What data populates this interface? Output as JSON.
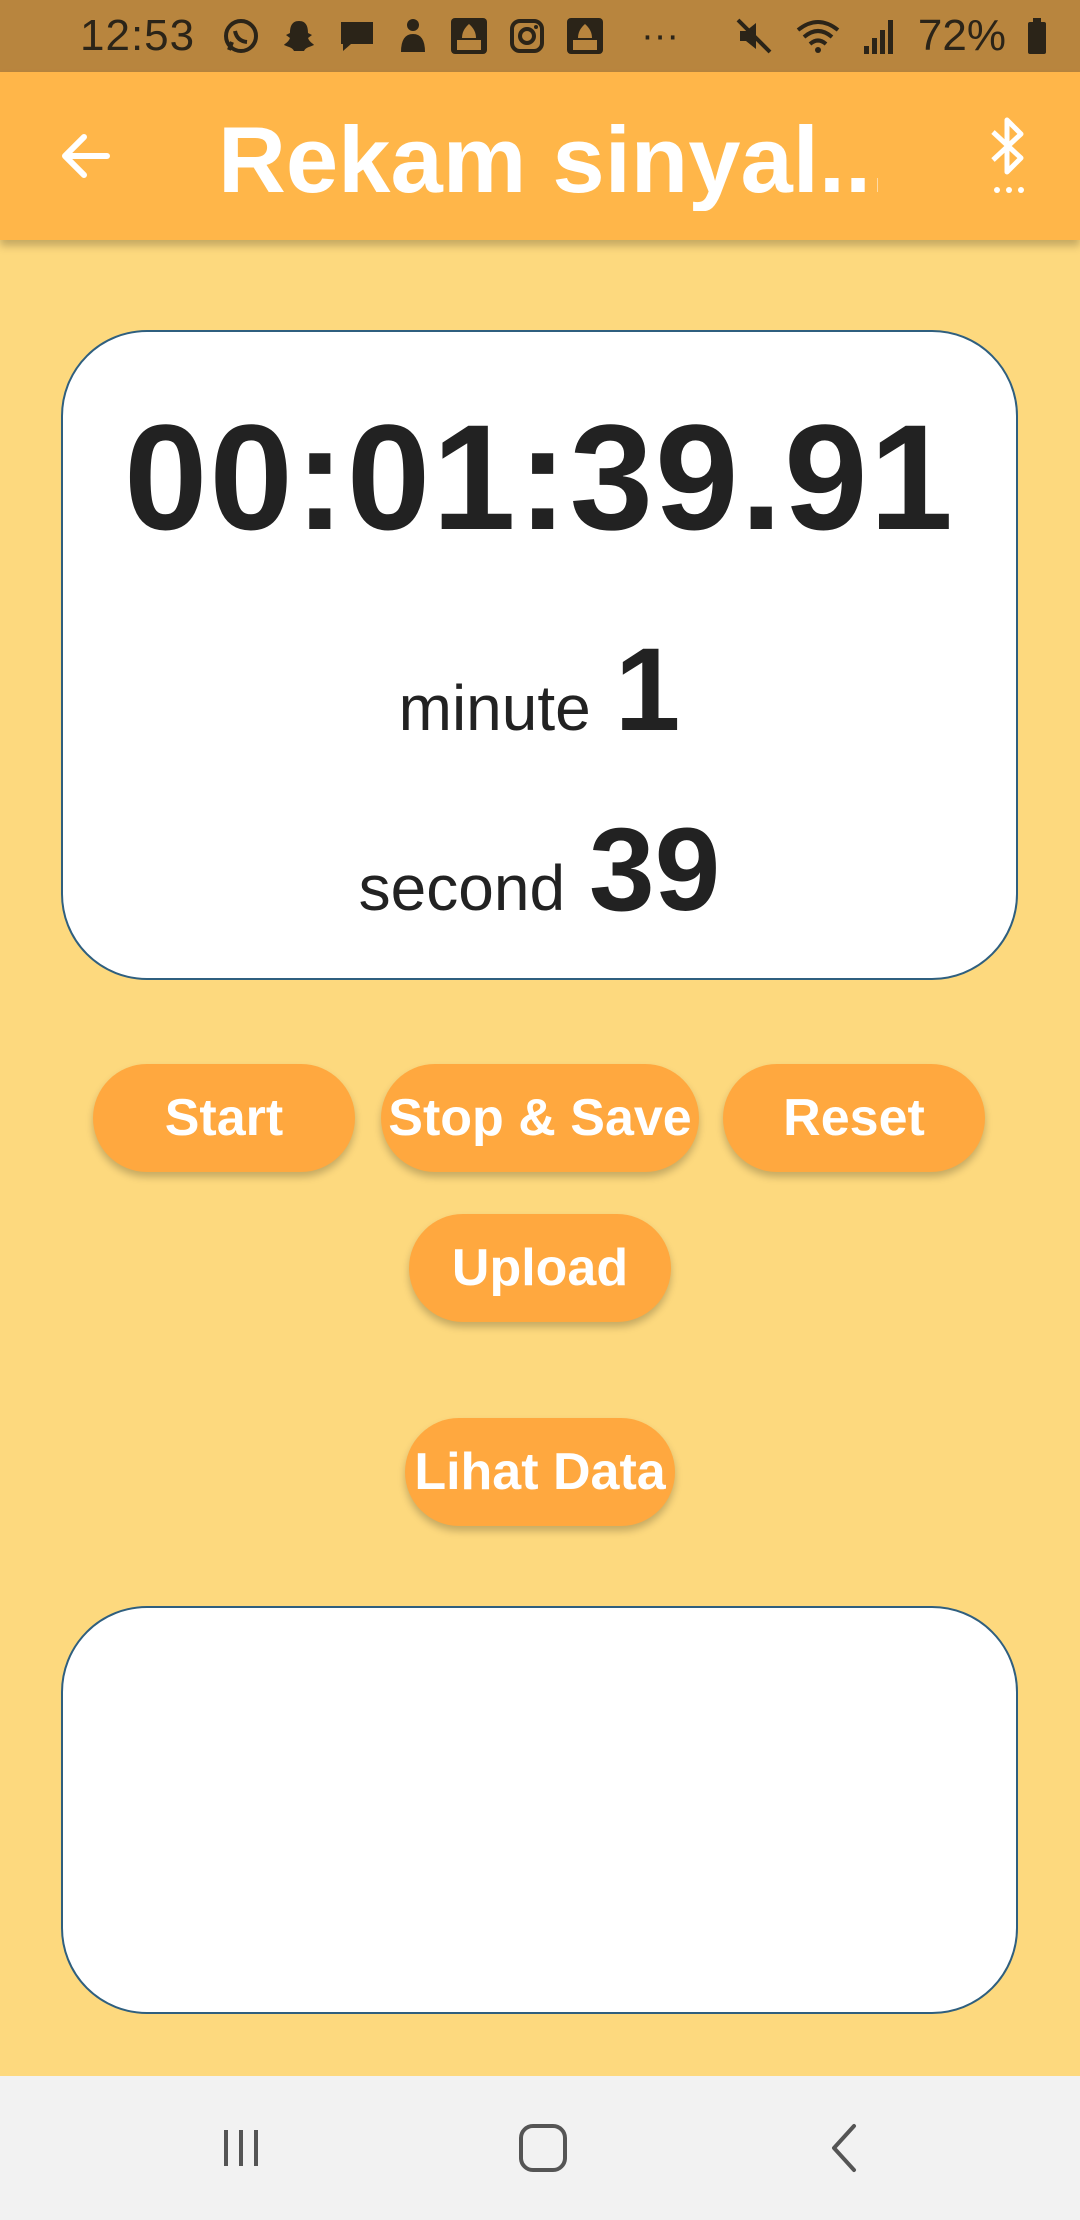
{
  "status_bar": {
    "time": "12:53",
    "battery": "72%",
    "overflow": "···"
  },
  "app_bar": {
    "title": "Rekam sinyal..."
  },
  "timer": {
    "elapsed": "00:01:39.91",
    "minute_label": "minute",
    "minute_value": "1",
    "second_label": "second",
    "second_value": "39"
  },
  "buttons": {
    "start": "Start",
    "stop_save": "Stop & Save",
    "reset": "Reset",
    "upload": "Upload",
    "view_data": "Lihat Data"
  },
  "colors": {
    "background": "#fdd97e",
    "app_bar": "#ffb649",
    "status_bar": "#b8853e",
    "button": "#ffa83f",
    "card_border": "#2f5f7f"
  }
}
